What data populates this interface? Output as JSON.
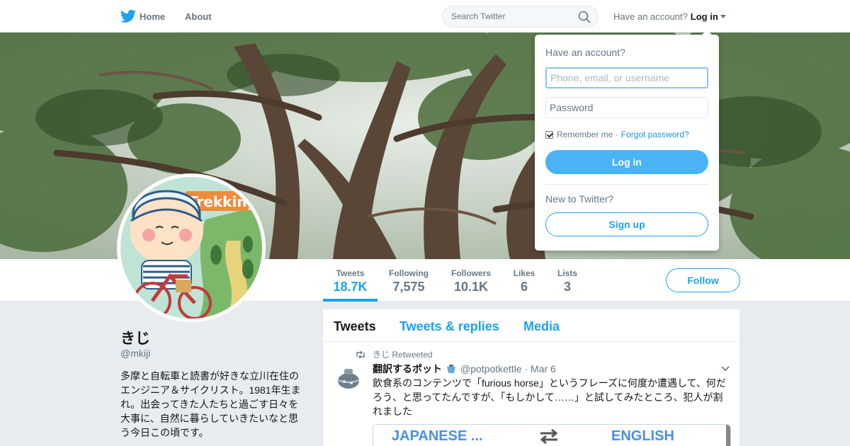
{
  "nav": {
    "home_label": "Home",
    "about_label": "About"
  },
  "search": {
    "placeholder": "Search Twitter"
  },
  "account": {
    "prompt": "Have an account?",
    "login_label": "Log in"
  },
  "stats": [
    {
      "label": "Tweets",
      "value": "18.7K"
    },
    {
      "label": "Following",
      "value": "7,575"
    },
    {
      "label": "Followers",
      "value": "10.1K"
    },
    {
      "label": "Likes",
      "value": "6"
    },
    {
      "label": "Lists",
      "value": "3"
    }
  ],
  "follow_label": "Follow",
  "profile": {
    "avatar_text": "Trekking",
    "name": "きじ",
    "handle": "@mkiji",
    "bio": "多摩と自転車と読書が好きな立川在住のエンジニア＆サイクリスト。1981年生まれ。出会ってきた人たちと過ごす日々を大事に、自然に暮らしていきたいなと思う今日この頃です。"
  },
  "timeline": {
    "tabs": [
      "Tweets",
      "Tweets & replies",
      "Media"
    ],
    "tweet": {
      "retweet_by": "きじ",
      "retweet_label": "Retweeted",
      "author_name": "翻訳するポット",
      "author_handle": "@potpotkettle",
      "date": "· Mar 6",
      "text": "飲食系のコンテンツで「furious horse」というフレーズに何度か遭遇して、何だろう、と思ってたんですが、「もしかして……」と試してみたところ、犯人が割れました",
      "card_left": "JAPANESE ...",
      "card_right": "ENGLISH"
    }
  },
  "login_dropdown": {
    "title": "Have an account?",
    "username_placeholder": "Phone, email, or username",
    "password_placeholder": "Password",
    "remember_label": "Remember me",
    "separator": "·",
    "forgot_label": "Forgot password?",
    "login_button": "Log in",
    "new_prompt": "New to Twitter?",
    "signup_button": "Sign up"
  },
  "colors": {
    "accent": "#1da1f2",
    "login_button": "#4ab3f4",
    "page_bg": "#e6ecf0"
  },
  "icons": [
    "twitter-bird-icon",
    "home-icon",
    "search-icon",
    "caret-down-icon",
    "retweet-icon",
    "kettle-emoji-icon",
    "tweet-caret-icon",
    "swap-arrows-icon",
    "checkbox-icon"
  ]
}
